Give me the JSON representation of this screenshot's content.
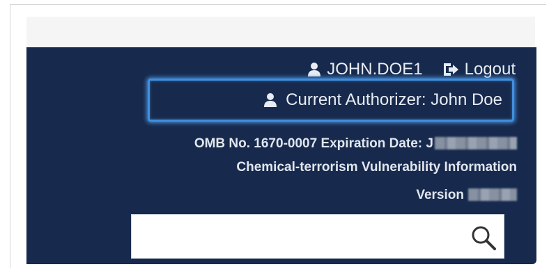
{
  "header": {
    "username": "JOHN.DOE1",
    "logout_label": "Logout",
    "authorizer_label": "Current Authorizer: John Doe",
    "omb_label": "OMB No. 1670-0007 Expiration Date: ",
    "omb_redacted_prefix": "J",
    "cvi_label": "Chemical-terrorism Vulnerability Information",
    "version_label": "Version"
  },
  "search": {
    "value": "",
    "placeholder": ""
  },
  "icons": {
    "user": "user-icon",
    "logout": "logout-icon",
    "search": "search-icon"
  },
  "colors": {
    "header_bg": "#172a4d",
    "highlight_border": "#3f8fe0",
    "header_text": "#e8ecf3"
  }
}
